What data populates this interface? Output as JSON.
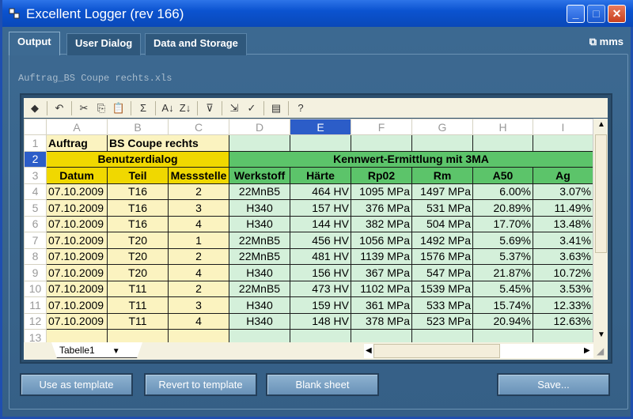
{
  "window": {
    "title": "Excellent Logger (rev 166)",
    "brand": "mms"
  },
  "tabs": [
    {
      "label": "Output"
    },
    {
      "label": "User Dialog"
    },
    {
      "label": "Data and Storage"
    }
  ],
  "filename": "Auftrag_BS Coupe rechts.xls",
  "toolbar": {
    "icons": [
      "office-logo",
      "undo",
      "cut",
      "copy",
      "paste",
      "autosum",
      "sort-ascending",
      "sort-descending",
      "autofilter",
      "export",
      "excel-import",
      "properties",
      "help"
    ],
    "glyphs": [
      "◆",
      "↶",
      "✂",
      "⎘",
      "📋",
      "Σ",
      "A↓",
      "Z↓",
      "⊽",
      "⇲",
      "✓",
      "▤",
      "?"
    ]
  },
  "spreadsheet": {
    "columns": [
      "A",
      "B",
      "C",
      "D",
      "E",
      "F",
      "G",
      "H",
      "I"
    ],
    "selected_column": "E",
    "selected_row": "2",
    "row1": {
      "num": "1",
      "a": "Auftrag",
      "bc": "BS Coupe rechts"
    },
    "row2": {
      "num": "2",
      "left": "Benutzerdialog",
      "right": "Kennwert-Ermittlung mit 3MA"
    },
    "row3": {
      "num": "3",
      "headers": [
        "Datum",
        "Teil",
        "Messstelle",
        "Werkstoff",
        "Härte",
        "Rp02",
        "Rm",
        "A50",
        "Ag"
      ]
    },
    "rows": [
      {
        "num": "4",
        "cells": [
          "07.10.2009",
          "T16",
          "2",
          "22MnB5",
          "464 HV",
          "1095 MPa",
          "1497 MPa",
          "6.00%",
          "3.07%"
        ]
      },
      {
        "num": "5",
        "cells": [
          "07.10.2009",
          "T16",
          "3",
          "H340",
          "157 HV",
          "376 MPa",
          "531 MPa",
          "20.89%",
          "11.49%"
        ]
      },
      {
        "num": "6",
        "cells": [
          "07.10.2009",
          "T16",
          "4",
          "H340",
          "144 HV",
          "382 MPa",
          "504 MPa",
          "17.70%",
          "13.48%"
        ]
      },
      {
        "num": "7",
        "cells": [
          "07.10.2009",
          "T20",
          "1",
          "22MnB5",
          "456 HV",
          "1056 MPa",
          "1492 MPa",
          "5.69%",
          "3.41%"
        ]
      },
      {
        "num": "8",
        "cells": [
          "07.10.2009",
          "T20",
          "2",
          "22MnB5",
          "481 HV",
          "1139 MPa",
          "1576 MPa",
          "5.37%",
          "3.63%"
        ]
      },
      {
        "num": "9",
        "cells": [
          "07.10.2009",
          "T20",
          "4",
          "H340",
          "156 HV",
          "367 MPa",
          "547 MPa",
          "21.87%",
          "10.72%"
        ]
      },
      {
        "num": "10",
        "cells": [
          "07.10.2009",
          "T11",
          "2",
          "22MnB5",
          "473 HV",
          "1102 MPa",
          "1539 MPa",
          "5.45%",
          "3.53%"
        ]
      },
      {
        "num": "11",
        "cells": [
          "07.10.2009",
          "T11",
          "3",
          "H340",
          "159 HV",
          "361 MPa",
          "533 MPa",
          "15.74%",
          "12.33%"
        ]
      },
      {
        "num": "12",
        "cells": [
          "07.10.2009",
          "T11",
          "4",
          "H340",
          "148 HV",
          "378 MPa",
          "523 MPa",
          "20.94%",
          "12.63%"
        ]
      }
    ],
    "row13": {
      "num": "13"
    },
    "sheet_tab": "Tabelle1"
  },
  "buttons": {
    "use_template": "Use as template",
    "revert": "Revert to template",
    "blank": "Blank sheet",
    "save": "Save..."
  }
}
